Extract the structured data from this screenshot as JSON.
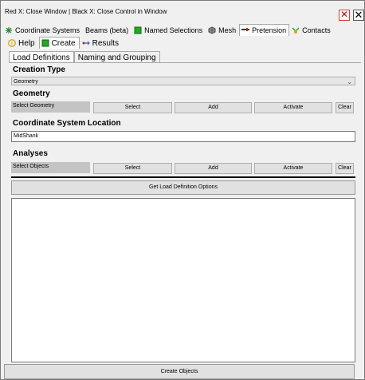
{
  "window": {
    "title": "Red X: Close Window | Black X: Close Control in Window",
    "close_window_glyph": "✕",
    "close_control_glyph": "✕"
  },
  "top_tabs": [
    {
      "label": "Coordinate Systems",
      "icon": "coordinate-systems-icon"
    },
    {
      "label": "Beams (beta)",
      "icon": ""
    },
    {
      "label": "Named Selections",
      "icon": "named-selections-icon"
    },
    {
      "label": "Mesh",
      "icon": "mesh-icon"
    },
    {
      "label": "Pretension",
      "icon": "pretension-icon",
      "active": true
    },
    {
      "label": "Contacts",
      "icon": "contacts-icon"
    }
  ],
  "sub_tabs": [
    {
      "label": "Help",
      "icon": "help-icon"
    },
    {
      "label": "Create",
      "icon": "create-icon",
      "active": true
    },
    {
      "label": "Results",
      "icon": "results-icon"
    }
  ],
  "inner_tabs": [
    {
      "label": "Load Definitions",
      "active": true
    },
    {
      "label": "Naming and Grouping"
    }
  ],
  "creation_type": {
    "heading": "Creation Type",
    "value": "Geometry",
    "dropdown_glyph": "⌄"
  },
  "geometry": {
    "heading": "Geometry",
    "field_text": "Select Geometry",
    "select_label": "Select",
    "add_label": "Add",
    "activate_label": "Activate",
    "clear_label": "Clear"
  },
  "coordinate_system": {
    "heading": "Coordinate System Location",
    "value": "MidShank"
  },
  "analyses": {
    "heading": "Analyses",
    "field_text": "Select Objects",
    "select_label": "Select",
    "add_label": "Add",
    "activate_label": "Activate",
    "clear_label": "Clear"
  },
  "get_options_label": "Get Load Definition Options",
  "create_objects_label": "Create Objects",
  "colors": {
    "accent_green": "#22aa22",
    "red_close": "#d00000",
    "field_gray": "#c4c4c4"
  }
}
